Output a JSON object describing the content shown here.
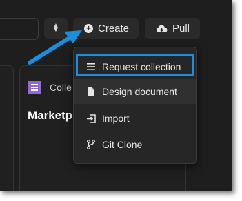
{
  "toolbar": {
    "create_label": "Create",
    "pull_label": "Pull"
  },
  "card": {
    "type_label": "Colle",
    "title": "Marketp"
  },
  "menu": {
    "items": [
      {
        "label": "Request collection",
        "icon": "list-icon"
      },
      {
        "label": "Design document",
        "icon": "document-icon"
      },
      {
        "label": "Import",
        "icon": "import-icon"
      },
      {
        "label": "Git Clone",
        "icon": "git-branch-icon"
      }
    ]
  },
  "colors": {
    "highlight": "#1a8fe0",
    "collection_icon": "#8d6bd1",
    "background": "#1e1e1e"
  }
}
